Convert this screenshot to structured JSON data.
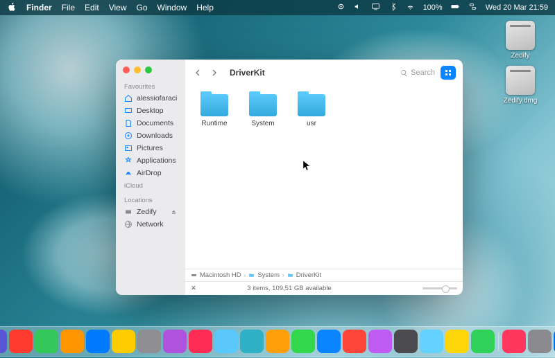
{
  "menubar": {
    "app": "Finder",
    "items": [
      "File",
      "Edit",
      "View",
      "Go",
      "Window",
      "Help"
    ],
    "battery": "100%",
    "clock": "Wed 20 Mar  21:59"
  },
  "desktop": {
    "icons": [
      {
        "label": "Zedify"
      },
      {
        "label": "Zedify.dmg"
      }
    ]
  },
  "finder": {
    "title": "DriverKit",
    "search_placeholder": "Search",
    "sidebar": {
      "favourites_header": "Favourites",
      "favourites": [
        {
          "icon": "home",
          "label": "alessiofaraci"
        },
        {
          "icon": "desktop",
          "label": "Desktop"
        },
        {
          "icon": "doc",
          "label": "Documents"
        },
        {
          "icon": "down",
          "label": "Downloads"
        },
        {
          "icon": "pic",
          "label": "Pictures"
        },
        {
          "icon": "app",
          "label": "Applications"
        },
        {
          "icon": "airdrop",
          "label": "AirDrop"
        }
      ],
      "icloud_header": "iCloud",
      "locations_header": "Locations",
      "locations": [
        {
          "icon": "disk",
          "label": "Zedify",
          "eject": true
        },
        {
          "icon": "net",
          "label": "Network"
        }
      ]
    },
    "folders": [
      {
        "label": "Runtime"
      },
      {
        "label": "System"
      },
      {
        "label": "usr"
      }
    ],
    "path": [
      {
        "icon": "disk",
        "label": "Macintosh HD"
      },
      {
        "icon": "folder",
        "label": "System"
      },
      {
        "icon": "folder",
        "label": "DriverKit"
      }
    ],
    "status": "3 items, 109,51 GB available"
  },
  "dock_colors": [
    "#4a90e2",
    "#5856d6",
    "#ff3b30",
    "#34c759",
    "#ff9500",
    "#007aff",
    "#ffcc00",
    "#8e8e93",
    "#af52de",
    "#ff2d55",
    "#5ac8fa",
    "#30b0c7",
    "#ff9f0a",
    "#32d74b",
    "#0a84ff",
    "#ff453a",
    "#bf5af2",
    "#4b4b4f",
    "#64d2ff",
    "#ffd60a",
    "#30d158",
    "#ff375f",
    "#8a8a8e",
    "#0071e3",
    "#6e6e73"
  ]
}
